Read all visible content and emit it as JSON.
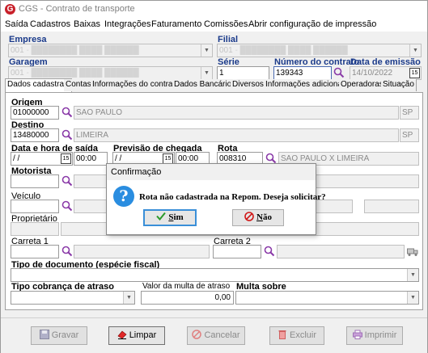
{
  "window": {
    "title": "CGS - Contrato de transporte",
    "app_icon": "G"
  },
  "menu": [
    "Saída",
    "Cadastros",
    "Baixas",
    "Integrações",
    "Faturamento",
    "Comissões",
    "Abrir configuração de impressão"
  ],
  "header": {
    "empresa_label": "Empresa",
    "empresa_value": "001",
    "filial_label": "Filial",
    "filial_value": "001",
    "garagem_label": "Garagem",
    "garagem_value": "001",
    "serie_label": "Série",
    "serie_value": "1",
    "numero_label": "Número do contrato",
    "numero_value": "139343",
    "emissao_label": "Data de emissão",
    "emissao_value": "14/10/2022"
  },
  "tabs": [
    "Dados cadastrais",
    "Contas",
    "Informações do contrato",
    "Dados Bancários",
    "Diversos",
    "Informações adicionais",
    "Operadoras",
    "Situação"
  ],
  "form": {
    "origem_label": "Origem",
    "origem_code": "01000000",
    "origem_city": "SAO PAULO",
    "origem_uf": "SP",
    "destino_label": "Destino",
    "destino_code": "13480000",
    "destino_city": "LIMEIRA",
    "destino_uf": "SP",
    "saida_label": "Data e hora de saída",
    "saida_date": " / /",
    "saida_time": "00:00",
    "previsao_label": "Previsão de chegada",
    "previsao_date": " / /",
    "previsao_time": "00:00",
    "rota_label": "Rota",
    "rota_code": "008310",
    "rota_desc": "SAO PAULO X LIMEIRA",
    "motorista_label": "Motorista",
    "veiculo_label": "Veículo",
    "proprietario_label": "Proprietário",
    "carreta1_label": "Carreta 1",
    "carreta2_label": "Carreta 2",
    "tipo_doc_label": "Tipo de documento (espécie fiscal)",
    "tipo_cobranca_label": "Tipo cobrança de atraso",
    "valor_multa_label": "Valor da multa de atraso",
    "valor_multa_value": "0,00",
    "multa_sobre_label": "Multa sobre"
  },
  "buttons": {
    "gravar": "Gravar",
    "limpar": "Limpar",
    "cancelar": "Cancelar",
    "excluir": "Excluir",
    "imprimir": "Imprimir"
  },
  "dialog": {
    "title": "Confirmação",
    "message": "Rota não cadastrada na Repom. Deseja solicitar?",
    "yes_pre": "",
    "yes_ul": "S",
    "yes_post": "im",
    "no_pre": "",
    "no_ul": "N",
    "no_post": "ão"
  },
  "colors": {
    "section_label": "#1a3a8a",
    "accent_blue": "#2a8de0",
    "no_red": "#d01818",
    "yes_green": "#2a9a2a"
  }
}
